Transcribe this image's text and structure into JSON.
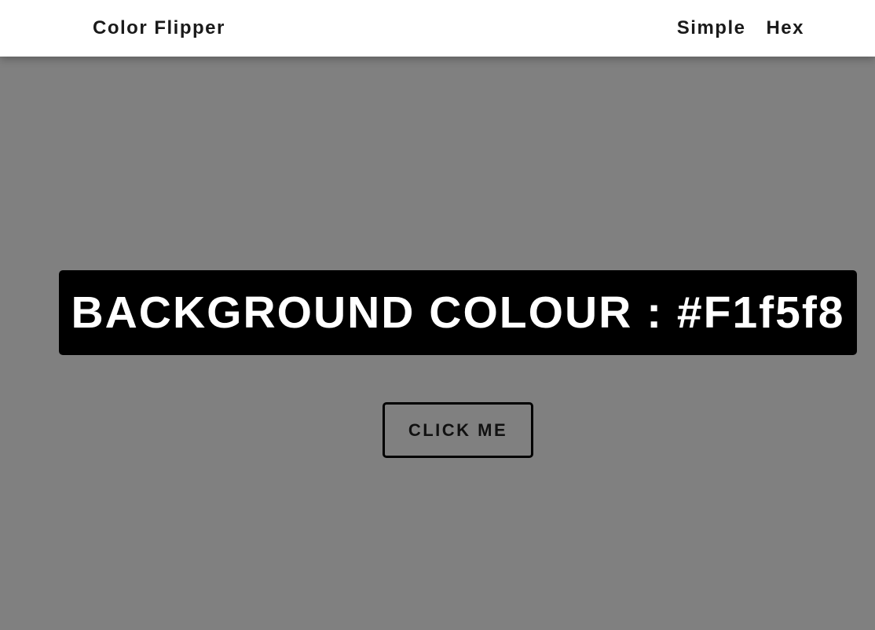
{
  "navbar": {
    "brand": "Color Flipper",
    "links": [
      {
        "label": "Simple"
      },
      {
        "label": "Hex"
      }
    ]
  },
  "main": {
    "background_label": "BACKGROUND COLOUR : #F1f5f8",
    "button_label": "CLICK ME",
    "page_background_color": "#808080",
    "banner_color": "#000000"
  }
}
